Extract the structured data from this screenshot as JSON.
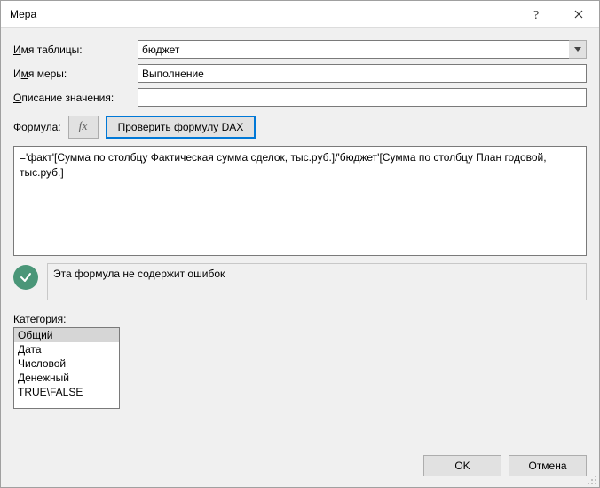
{
  "titlebar": {
    "title": "Мера"
  },
  "labels": {
    "table": "Имя таблицы:",
    "table_u": "И",
    "measure": "мя меры:",
    "measure_u": "И",
    "desc": "писание значения:",
    "desc_u": "О",
    "formula": "ормула:",
    "formula_u": "Ф",
    "fx": "fx",
    "dax_u": "П",
    "dax": "роверить формулу DAX",
    "category_u": "К",
    "category": "атегория:"
  },
  "fields": {
    "table": "бюджет",
    "measure": "Выполнение",
    "desc": "",
    "formula": "='факт'[Сумма по столбцу Фактическая сумма сделок, тыс.руб.]/'бюджет'[Сумма по столбцу План годовой, тыс.руб.]"
  },
  "status": {
    "message": "Эта формула не содержит ошибок"
  },
  "categories": [
    "Общий",
    "Дата",
    "Числовой",
    "Денежный",
    "TRUE\\FALSE"
  ],
  "selected_category_index": 0,
  "buttons": {
    "ok": "OK",
    "cancel": "Отмена"
  }
}
